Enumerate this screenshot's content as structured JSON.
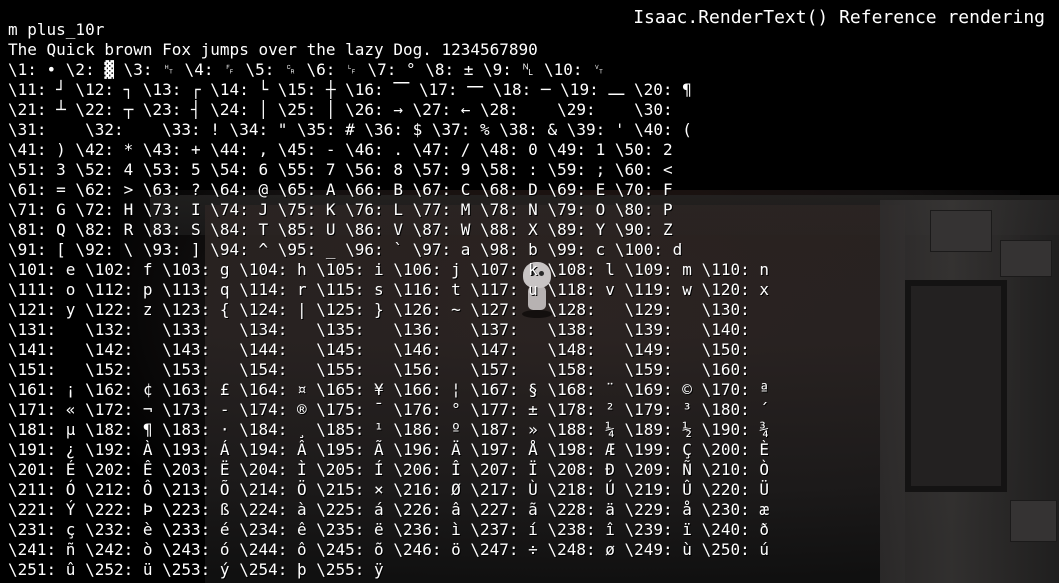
{
  "title": "Isaac.RenderText() Reference rendering",
  "font_name": "m plus_10r",
  "pangram": "The Quick brown Fox jumps over the lazy Dog. 1234567890",
  "lines": [
    "\\1: • \\2: ▓ \\3: ␉ \\4: ␌ \\5: ␍ \\6: ␊ \\7: ° \\8: ± \\9: ␤ \\10: ␋",
    "\\11: ┘ \\12: ┐ \\13: ┌ \\14: └ \\15: ┼ \\16: ⎺ \\17: ⎻ \\18: ─ \\19: ⎼ \\20: ¶",
    "\\21: ┴ \\22: ┬ \\23: ┤ \\24: │ \\25: │ \\26: → \\27: ← \\28:    \\29:    \\30:",
    "\\31:    \\32:    \\33: ! \\34: \" \\35: # \\36: $ \\37: % \\38: & \\39: ' \\40: (",
    "\\41: ) \\42: * \\43: + \\44: , \\45: - \\46: . \\47: / \\48: 0 \\49: 1 \\50: 2",
    "\\51: 3 \\52: 4 \\53: 5 \\54: 6 \\55: 7 \\56: 8 \\57: 9 \\58: : \\59: ; \\60: <",
    "\\61: = \\62: > \\63: ? \\64: @ \\65: A \\66: B \\67: C \\68: D \\69: E \\70: F",
    "\\71: G \\72: H \\73: I \\74: J \\75: K \\76: L \\77: M \\78: N \\79: O \\80: P",
    "\\81: Q \\82: R \\83: S \\84: T \\85: U \\86: V \\87: W \\88: X \\89: Y \\90: Z",
    "\\91: [ \\92: \\ \\93: ] \\94: ^ \\95: _ \\96: ` \\97: a \\98: b \\99: c \\100: d",
    "\\101: e \\102: f \\103: g \\104: h \\105: i \\106: j \\107: k \\108: l \\109: m \\110: n",
    "\\111: o \\112: p \\113: q \\114: r \\115: s \\116: t \\117: u \\118: v \\119: w \\120: x",
    "\\121: y \\122: z \\123: { \\124: | \\125: } \\126: ~ \\127:   \\128:   \\129:   \\130:",
    "\\131:   \\132:   \\133:   \\134:   \\135:   \\136:   \\137:   \\138:   \\139:   \\140:",
    "\\141:   \\142:   \\143:   \\144:   \\145:   \\146:   \\147:   \\148:   \\149:   \\150:",
    "\\151:   \\152:   \\153:   \\154:   \\155:   \\156:   \\157:   \\158:   \\159:   \\160:",
    "\\161: ¡ \\162: ¢ \\163: £ \\164: ¤ \\165: ¥ \\166: ¦ \\167: § \\168: ¨ \\169: © \\170: ª",
    "\\171: « \\172: ¬ \\173: - \\174: ® \\175: ¯ \\176: ° \\177: ± \\178: ² \\179: ³ \\180: ´",
    "\\181: µ \\182: ¶ \\183: · \\184: ¸ \\185: ¹ \\186: º \\187: » \\188: ¼ \\189: ½ \\190: ¾",
    "\\191: ¿ \\192: À \\193: Á \\194: Â \\195: Ã \\196: Ä \\197: Å \\198: Æ \\199: Ç \\200: È",
    "\\201: É \\202: Ê \\203: Ë \\204: Ì \\205: Í \\206: Î \\207: Ï \\208: Ð \\209: Ñ \\210: Ò",
    "\\211: Ó \\212: Ô \\213: Õ \\214: Ö \\215: × \\216: Ø \\217: Ù \\218: Ú \\219: Û \\220: Ü",
    "\\221: Ý \\222: Þ \\223: ß \\224: à \\225: á \\226: â \\227: ã \\228: ä \\229: å \\230: æ",
    "\\231: ç \\232: è \\233: é \\234: ê \\235: ë \\236: ì \\237: í \\238: î \\239: ï \\240: ð",
    "\\241: ñ \\242: ò \\243: ó \\244: ô \\245: õ \\246: ö \\247: ÷ \\248: ø \\249: ù \\250: ú",
    "\\251: û \\252: ü \\253: ý \\254: þ \\255: ÿ"
  ]
}
